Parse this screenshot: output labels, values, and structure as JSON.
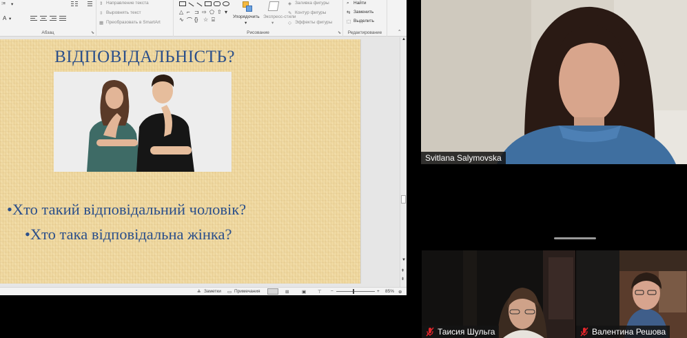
{
  "ribbon": {
    "groups": {
      "paragraph": "Абзац",
      "drawing": "Рисование",
      "editing": "Редактирование"
    },
    "paragraph_commands": {
      "text_direction": "Направление текста",
      "align_text": "Выровнять текст",
      "convert_smartart": "Преобразовать в SmartArt"
    },
    "drawing_commands": {
      "arrange": "Упорядочить",
      "quick_styles": "Экспресс-стили",
      "shape_fill": "Заливка фигуры",
      "shape_outline": "Контур фигуры",
      "shape_effects": "Эффекты фигуры"
    },
    "editing_commands": {
      "find": "Найти",
      "replace": "Заменить",
      "select": "Выделить"
    }
  },
  "slide": {
    "title": "ВІДПОВІДАЛЬНІСТЬ?",
    "bullets": [
      "•Хто такий відповідальний чоловік?",
      "•Хто така відповідальна жінка?"
    ]
  },
  "statusbar": {
    "notes": "Заметки",
    "comments": "Примечания",
    "zoom": "85%"
  },
  "participants": {
    "main": {
      "name": "Svitlana Salymovska"
    },
    "p2": {
      "name": "Таисия Шульга"
    },
    "p3": {
      "name": "Валентина Решова"
    }
  },
  "colors": {
    "slide_text": "#2b4f8a",
    "slide_bg": "#f0d9a1",
    "muted_mic": "#e0262b"
  }
}
